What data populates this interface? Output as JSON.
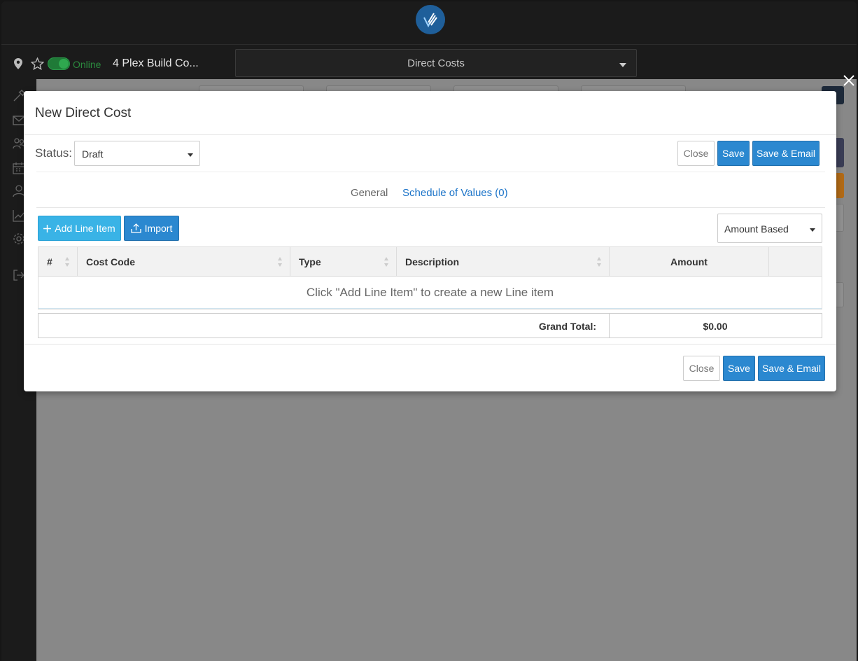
{
  "nav": {
    "status": "Online",
    "project": "4 Plex Build Co...",
    "module": "Direct Costs"
  },
  "modal": {
    "title": "New Direct Cost",
    "status_label": "Status:",
    "status_value": "Draft",
    "buttons": {
      "close": "Close",
      "save": "Save",
      "save_email": "Save & Email"
    },
    "tabs": {
      "general": "General",
      "sov": "Schedule of Values (0)"
    },
    "toolbar": {
      "add_line_item": "Add Line Item",
      "import": "Import",
      "mode": "Amount Based"
    },
    "table": {
      "columns": [
        "#",
        "Cost Code",
        "Type",
        "Description",
        "Amount"
      ],
      "empty_message": "Click \"Add Line Item\" to create a new Line item"
    },
    "totals": {
      "label": "Grand Total:",
      "value": "$0.00"
    }
  },
  "colors": {
    "primary": "#2b88d0",
    "info": "#39b3e6",
    "link": "#1a73c8",
    "online": "#2b8a3e"
  }
}
